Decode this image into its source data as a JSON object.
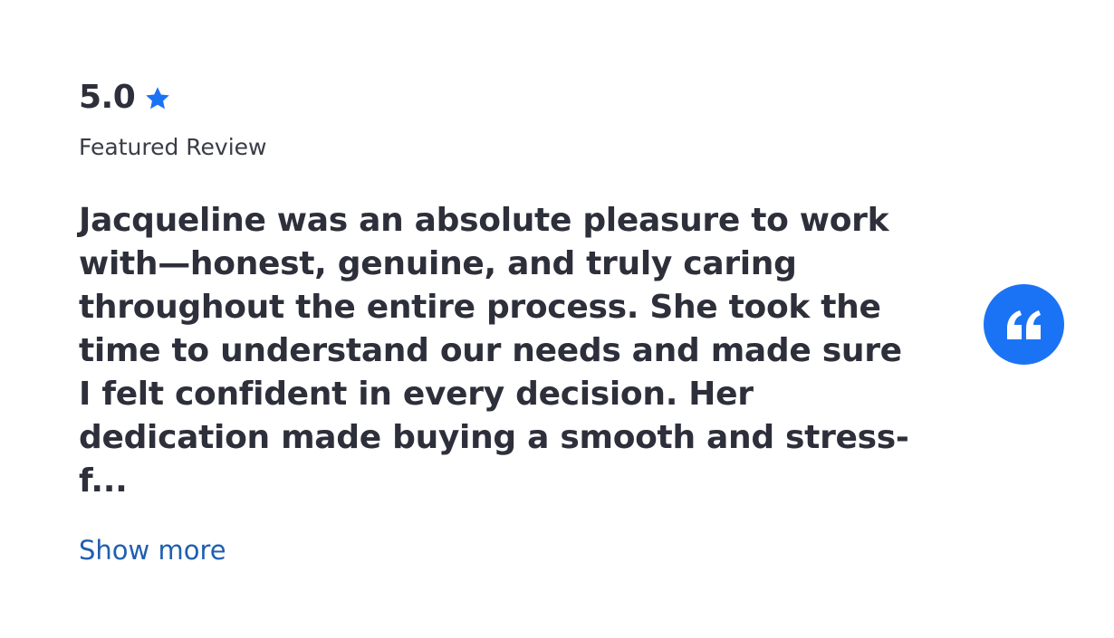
{
  "rating": {
    "value": "5.0",
    "star_icon": "star-icon"
  },
  "featured_label": "Featured Review",
  "review": {
    "lines": [
      "Jacqueline was an absolute pleasure to work",
      "with—honest, genuine, and truly caring",
      "throughout the entire process. She took the",
      "time to understand our needs and made sure",
      "I felt confident in every decision. Her",
      "dedication made buying a smooth and stress-",
      "f..."
    ]
  },
  "show_more_label": "Show more",
  "quote_icon": "quote-icon",
  "colors": {
    "accent": "#1a73f5",
    "text": "#2d2f3a",
    "link": "#1f5fb0"
  }
}
